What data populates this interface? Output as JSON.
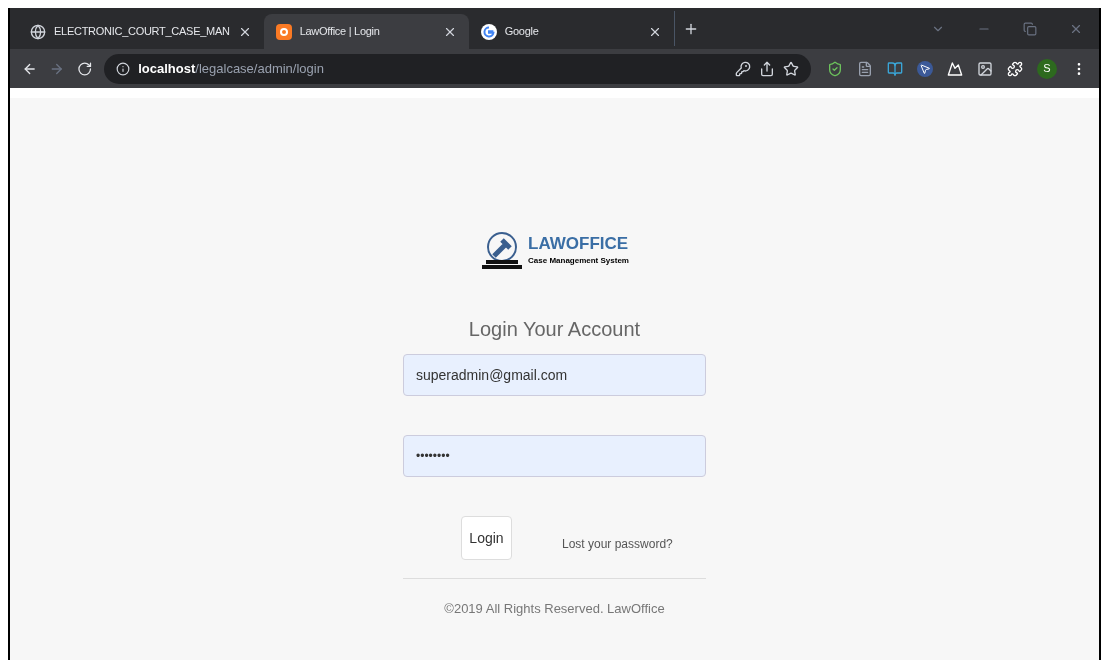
{
  "browser": {
    "tabs": [
      {
        "title": "ELECTRONIC_COURT_CASE_MAN",
        "kind": "globe",
        "selected": false
      },
      {
        "title": "LawOffice | Login",
        "kind": "xampp",
        "selected": true
      },
      {
        "title": "Google",
        "kind": "google",
        "selected": false
      }
    ],
    "address": {
      "host": "localhost",
      "path": "/legalcase/admin/login"
    },
    "profile": "S"
  },
  "page": {
    "logo": {
      "name": "LAWOFFICE",
      "tagline": "Case Management System"
    },
    "heading": "Login Your Account",
    "email": {
      "value": "superadmin@gmail.com"
    },
    "password": {
      "value": "••••••••"
    },
    "login_button": "Login",
    "forgot_link": "Lost your password?",
    "footer": "©2019 All Rights Reserved. LawOffice"
  }
}
